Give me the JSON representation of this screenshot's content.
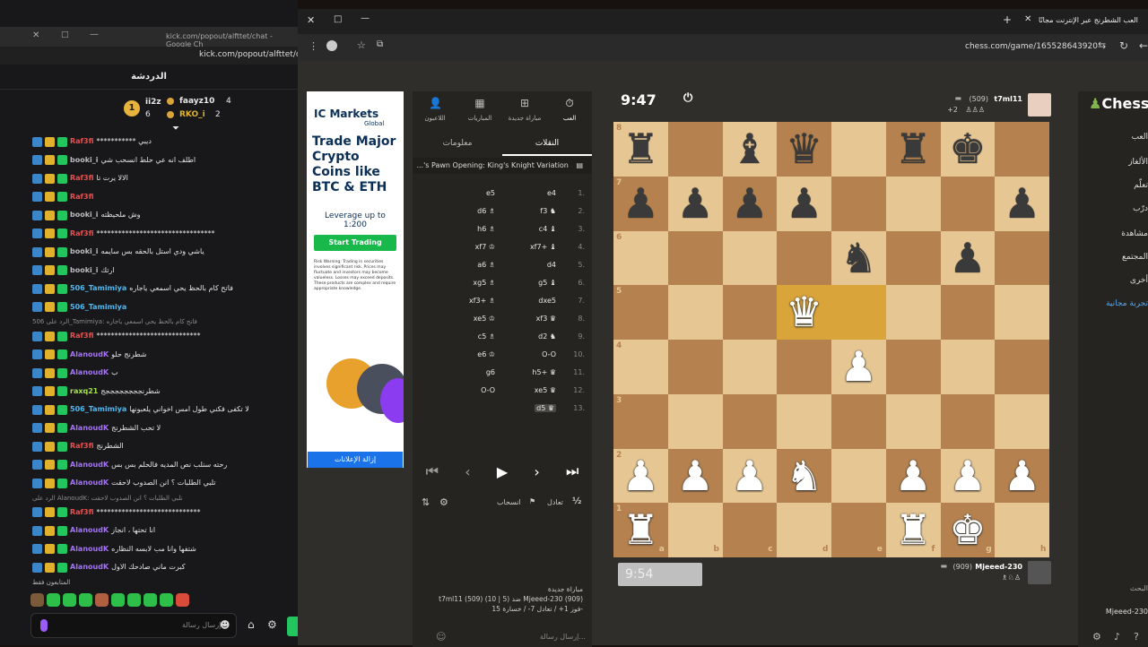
{
  "left_window": {
    "url_title": "kick.com/popout/alfttet/chat - Google Ch",
    "address": "kick.com/popout/alfttet/chat",
    "chat_title": "الدردشة",
    "leaderboard": {
      "rank": "1",
      "entries": [
        {
          "name": "ii2z",
          "count": "6",
          "side_name": "faayz10",
          "side_count": "4"
        },
        {
          "name": "",
          "count": "",
          "side_name": "RKO_i",
          "side_count": "2"
        }
      ]
    },
    "messages": [
      {
        "user": "Raf3fi",
        "color": "#e7504d",
        "text": "*********** ديبي"
      },
      {
        "user": "booki_i",
        "color": "#bbbbbb",
        "text": "اطلف انه عي حلط انسحب شي"
      },
      {
        "user": "Raf3fi",
        "color": "#e7504d",
        "text": "الالا يرت تا"
      },
      {
        "user": "Raf3fi",
        "color": "#e7504d",
        "text": ""
      },
      {
        "user": "booki_i",
        "color": "#bbbbbb",
        "text": "وش ملحيظته"
      },
      {
        "user": "Raf3fi",
        "color": "#e7504d",
        "text": "*********************************"
      },
      {
        "user": "booki_i",
        "color": "#bbbbbb",
        "text": "ياشي ودي استل بالحقه بس سايمه"
      },
      {
        "user": "booki_i",
        "color": "#bbbbbb",
        "text": "ارتك"
      },
      {
        "user": "506_Tamimiya",
        "color": "#4fb8f0",
        "text": "فاتح كام بالحظ يحي اسمعي ياجاره"
      },
      {
        "user": "506_Tamimiya",
        "color": "#4fb8f0",
        "text": ""
      },
      {
        "user": "Raf3fi",
        "color": "#e7504d",
        "text": "*****************************",
        "reply": "الرد على 506_Tamimiya: فاتح كام بالحظ يحي اسمعي ياجاره"
      },
      {
        "user": "AlanoudK",
        "color": "#a274f2",
        "text": "شطرنج حلو"
      },
      {
        "user": "AlanoudK",
        "color": "#a274f2",
        "text": "ب"
      },
      {
        "user": "raxq21",
        "color": "#a3e24a",
        "text": "شطرنججججججججج"
      },
      {
        "user": "506_Tamimiya",
        "color": "#4fb8f0",
        "text": "لا تكفى فكني طول امس اخواني يلعبونها"
      },
      {
        "user": "AlanoudK",
        "color": "#a274f2",
        "text": "لا تحب الشطرنج"
      },
      {
        "user": "Raf3fi",
        "color": "#e7504d",
        "text": "الشطرنج"
      },
      {
        "user": "AlanoudK",
        "color": "#a274f2",
        "text": "رحته سنلب نص المديه فالحلم بس بس"
      },
      {
        "user": "AlanoudK",
        "color": "#a274f2",
        "text": "تلبي الطلبات ؟ انن الصدوب لاحقت"
      },
      {
        "user": "Raf3fi",
        "color": "#e7504d",
        "text": "*****************************",
        "reply": "الرد على AlanoudK: تلبي الطلبات ؟ انن الصدوب لاحقت"
      },
      {
        "user": "AlanoudK",
        "color": "#a274f2",
        "text": "انا تحتها ، انجاز"
      },
      {
        "user": "AlanoudK",
        "color": "#a274f2",
        "text": "شتفها وانا مب لابسه النظاره"
      },
      {
        "user": "AlanoudK",
        "color": "#a274f2",
        "text": "كبرت ماني صادحك الاول"
      }
    ],
    "active_label": "المتابعون فقط",
    "input_placeholder": "إرسال رسالة"
  },
  "browser": {
    "tab_title": "العب الشطرنج عبر الإنترنت مجانًا",
    "url": "chess.com/game/165528643920"
  },
  "ad": {
    "brand": "IC Markets",
    "brand_sub": "Global",
    "headline": "Trade Major Crypto Coins like BTC & ETH",
    "leverage": "Leverage up to 1:200",
    "cta": "Start Trading",
    "risk": "Risk Warning: Trading in securities involves significant risk. Prices may fluctuate and investors may become valueless. Losses may exceed deposits. These products are complex and require appropriate knowledge.",
    "remove": "إزالة الإعلانات"
  },
  "panel": {
    "top_tabs": [
      "اللاعبون",
      "المباريات",
      "مباراة جديدة",
      "العب"
    ],
    "sub_tabs": {
      "active": "النقلات",
      "inactive": "معلومات"
    },
    "opening": "...'s Pawn Opening: King's Knight Variation",
    "moves": [
      {
        "n": "1.",
        "w": "e4",
        "b": "e5"
      },
      {
        "n": "2.",
        "w": "f3 ♞",
        "b": "d6 ♗"
      },
      {
        "n": "3.",
        "w": "c4 ♝",
        "b": "h6 ♗"
      },
      {
        "n": "4.",
        "w": "xf7+ ♝",
        "b": "xf7 ♔"
      },
      {
        "n": "5.",
        "w": "d4",
        "b": "a6 ♗"
      },
      {
        "n": "6.",
        "w": "g5 ♝",
        "b": "xg5 ♗"
      },
      {
        "n": "7.",
        "w": "dxe5",
        "b": "xf3+ ♗"
      },
      {
        "n": "8.",
        "w": "xf3 ♛",
        "b": "xe5 ♔"
      },
      {
        "n": "9.",
        "w": "d2 ♞",
        "b": "c5 ♗"
      },
      {
        "n": "10.",
        "w": "O-O",
        "b": "e6 ♔"
      },
      {
        "n": "11.",
        "w": "h5+ ♛",
        "b": "g6"
      },
      {
        "n": "12.",
        "w": "xe5 ♛",
        "b": "O-O"
      },
      {
        "n": "13.",
        "w": "d5 ♛",
        "b": ""
      }
    ],
    "actions": {
      "draw": "تعادل",
      "resign": "انسحاب"
    },
    "game_info": {
      "title": "مباراة جديدة",
      "line1": "t7ml11 (509) (10 | 5) ضد Mjeeed-230 (909)",
      "line2": "فوز 1+ / تعادل 7- / خسارة 15-"
    },
    "chat_placeholder": "إرسال رسالة..."
  },
  "board": {
    "top_clock": "9:47",
    "bottom_clock": "9:54",
    "top_player": "t7ml11",
    "top_rating": "(509)",
    "top_material": "+2",
    "bottom_player": "Mjeeed-230",
    "bottom_rating": "(909)",
    "files": [
      "a",
      "b",
      "c",
      "d",
      "e",
      "f",
      "g",
      "h"
    ],
    "ranks": [
      "8",
      "7",
      "6",
      "5",
      "4",
      "3",
      "2",
      "1"
    ],
    "pieces": [
      {
        "sq": "a8",
        "p": "♜",
        "c": "b"
      },
      {
        "sq": "c8",
        "p": "♝",
        "c": "b"
      },
      {
        "sq": "d8",
        "p": "♛",
        "c": "b"
      },
      {
        "sq": "f8",
        "p": "♜",
        "c": "b"
      },
      {
        "sq": "g8",
        "p": "♚",
        "c": "b"
      },
      {
        "sq": "a7",
        "p": "♟",
        "c": "b"
      },
      {
        "sq": "b7",
        "p": "♟",
        "c": "b"
      },
      {
        "sq": "c7",
        "p": "♟",
        "c": "b"
      },
      {
        "sq": "d7",
        "p": "♟",
        "c": "b"
      },
      {
        "sq": "h7",
        "p": "♟",
        "c": "b"
      },
      {
        "sq": "e6",
        "p": "♞",
        "c": "b"
      },
      {
        "sq": "g6",
        "p": "♟",
        "c": "b"
      },
      {
        "sq": "d5",
        "p": "♛",
        "c": "w"
      },
      {
        "sq": "e4",
        "p": "♟",
        "c": "w"
      },
      {
        "sq": "a2",
        "p": "♟",
        "c": "w"
      },
      {
        "sq": "b2",
        "p": "♟",
        "c": "w"
      },
      {
        "sq": "c2",
        "p": "♟",
        "c": "w"
      },
      {
        "sq": "d2",
        "p": "♞",
        "c": "w"
      },
      {
        "sq": "f2",
        "p": "♟",
        "c": "w"
      },
      {
        "sq": "g2",
        "p": "♟",
        "c": "w"
      },
      {
        "sq": "h2",
        "p": "♟",
        "c": "w"
      },
      {
        "sq": "a1",
        "p": "♜",
        "c": "w"
      },
      {
        "sq": "f1",
        "p": "♜",
        "c": "w"
      },
      {
        "sq": "g1",
        "p": "♚",
        "c": "w"
      }
    ],
    "highlight": [
      "d5",
      "e5"
    ]
  },
  "sidebar": {
    "logo": "Chess.com",
    "items": [
      "العب",
      "الألغاز",
      "تعلّم",
      "درّب",
      "مشاهدة",
      "المجتمع",
      "أخرى",
      "تجربة مجانية"
    ],
    "bottom_user": "Mjeeed-230",
    "search": "البحث"
  },
  "colors": {
    "board_light": "#e6c794",
    "board_dark": "#b5824f",
    "highlight": "#d9a43a",
    "accent_green": "#22c55e"
  }
}
